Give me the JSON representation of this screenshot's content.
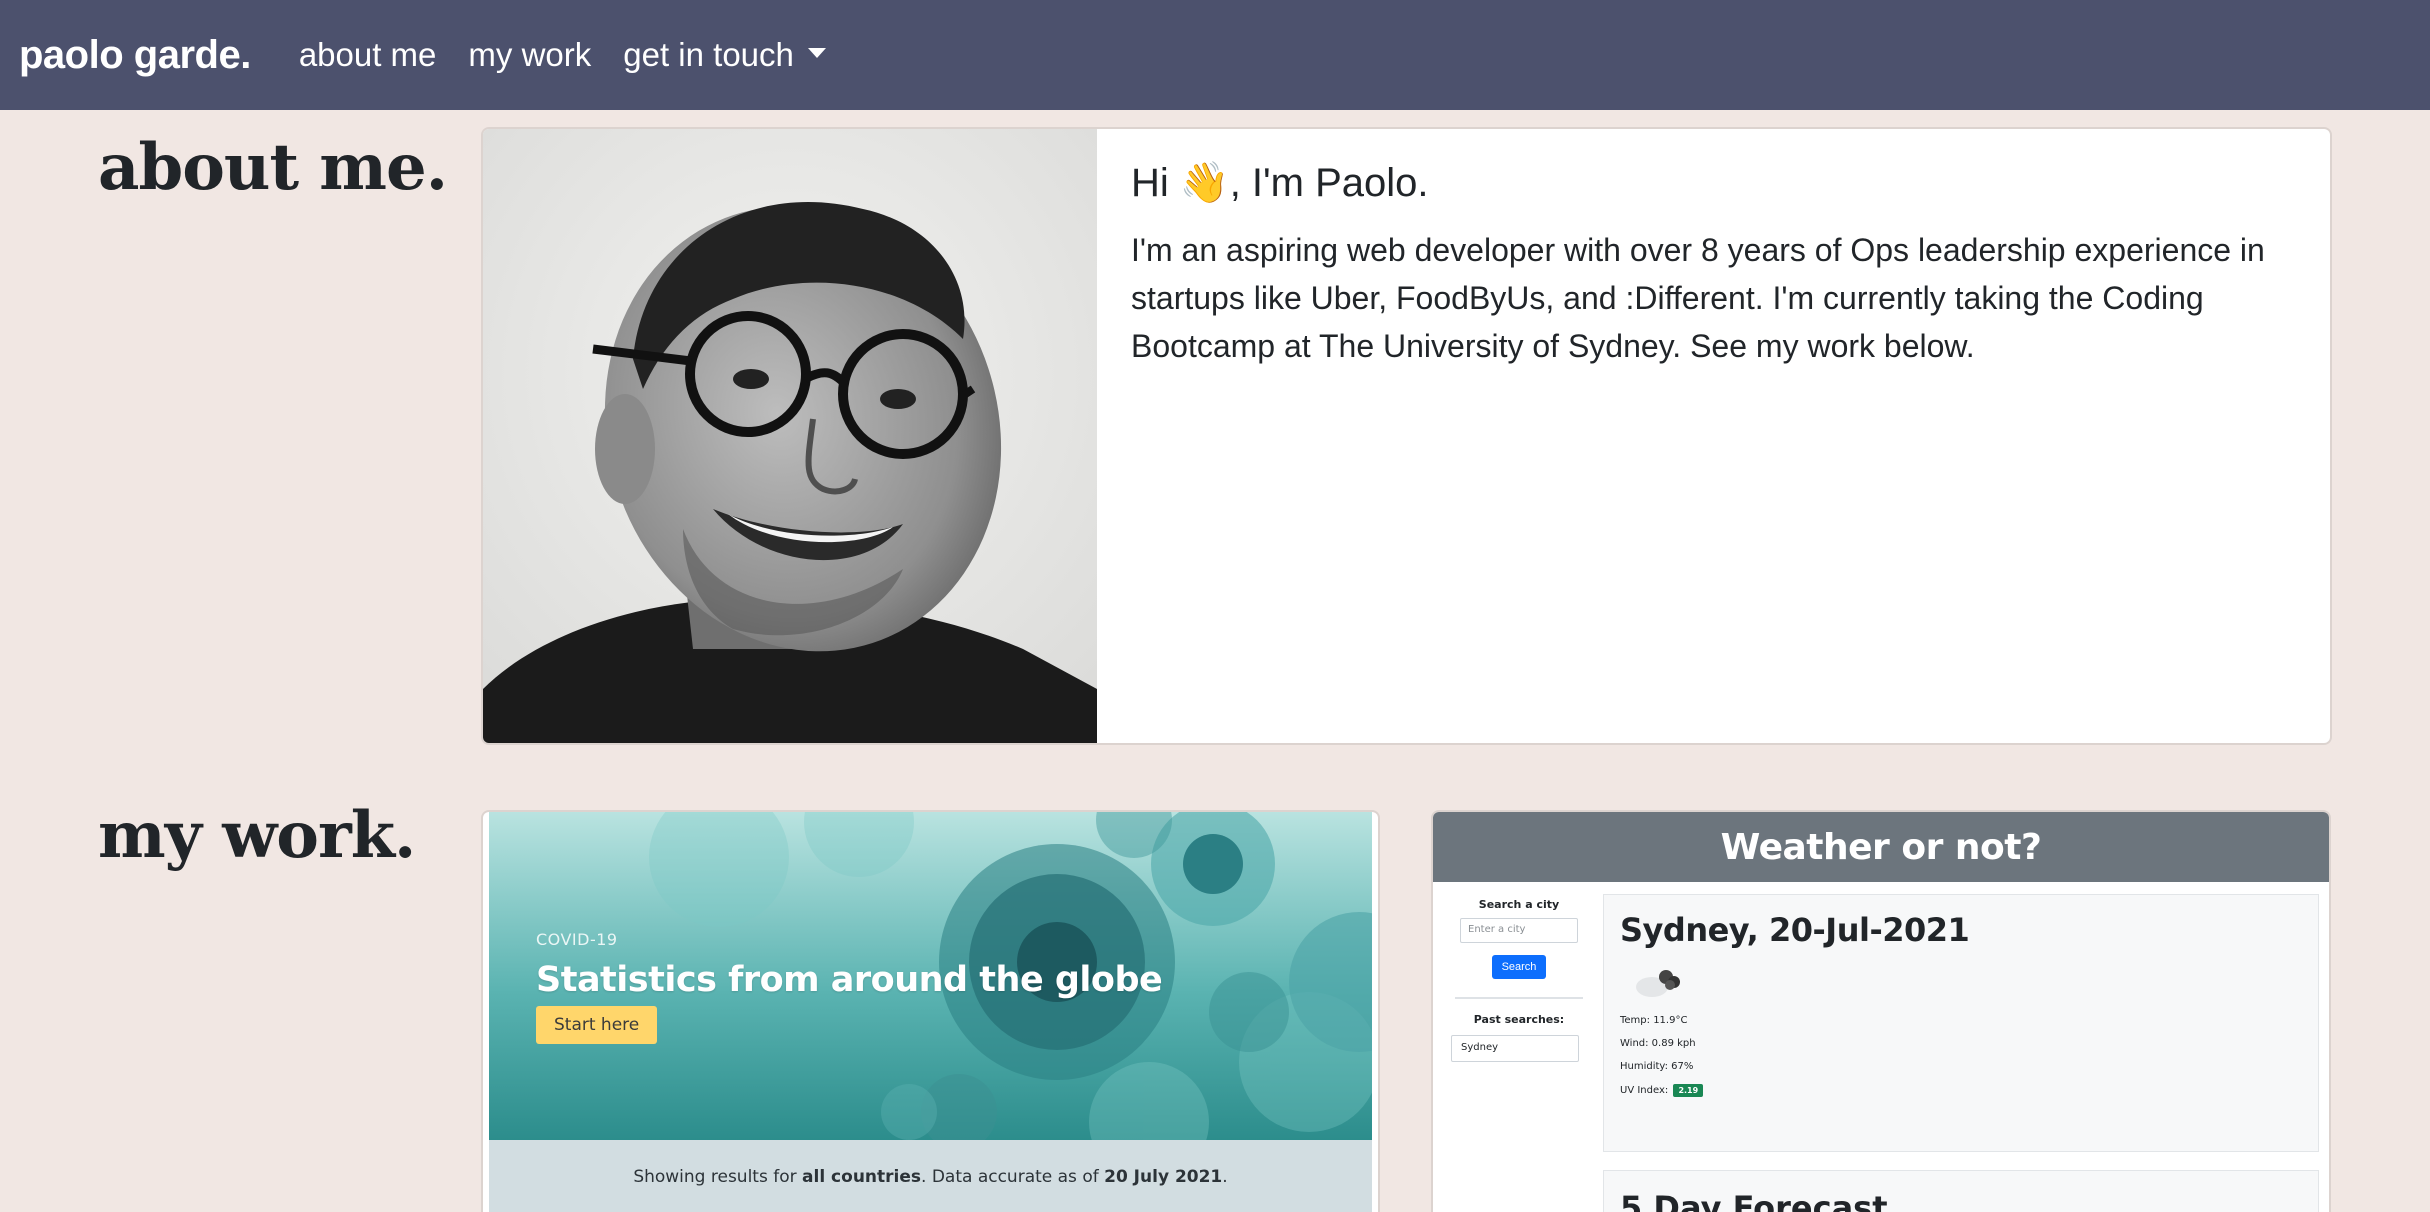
{
  "nav": {
    "brand": "paolo garde.",
    "links": [
      "about me",
      "my work"
    ],
    "dropdown_label": "get in touch"
  },
  "about": {
    "heading": "about me.",
    "greeting": "Hi 👋, I'm Paolo.",
    "text": "I'm an aspiring web developer with over 8 years of Ops leadership experience in startups like Uber, FoodByUs, and :Different. I'm currently taking the Coding Bootcamp at The University of Sydney. See my work below."
  },
  "work": {
    "heading": "my work.",
    "covid": {
      "kicker": "COVID-19",
      "title": "Statistics from around the globe",
      "button": "Start here",
      "strip_prefix": "Showing results for ",
      "strip_scope": "all countries",
      "strip_middle": ". Data accurate as of ",
      "strip_date": "20 July 2021",
      "strip_suffix": "."
    },
    "weather": {
      "title": "Weather or not?",
      "search_label": "Search a city",
      "search_placeholder": "Enter a city",
      "search_button": "Search",
      "past_label": "Past searches:",
      "past_items": [
        "Sydney"
      ],
      "city_date": "Sydney, 20-Jul-2021",
      "temp": "Temp: 11.9°C",
      "wind": "Wind: 0.89 kph",
      "humidity": "Humidity: 67%",
      "uv_label": "UV Index:",
      "uv_value": "2.19",
      "forecast_heading": "5 Day Forecast"
    }
  },
  "colors": {
    "navbar": "#4c516d",
    "page_bg": "#f1e7e3",
    "covid_button": "#ffd66b",
    "weather_header": "#6c757d",
    "search_button": "#0d6efd",
    "uv_badge": "#198754"
  }
}
